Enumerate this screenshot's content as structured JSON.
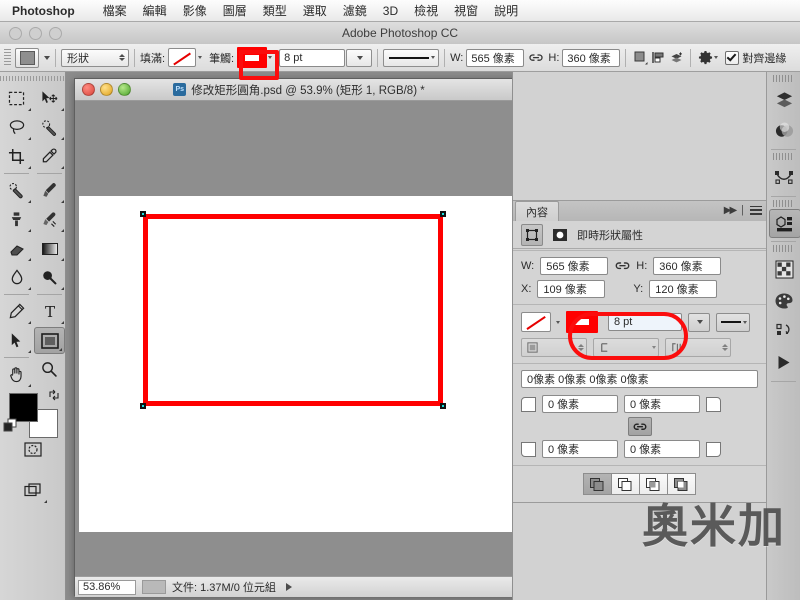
{
  "menubar": {
    "app_name": "Photoshop",
    "items": [
      "檔案",
      "編輯",
      "影像",
      "圖層",
      "類型",
      "選取",
      "濾鏡",
      "3D",
      "檢視",
      "視窗",
      "說明"
    ]
  },
  "window": {
    "title": "Adobe Photoshop CC"
  },
  "options_bar": {
    "tool_preset_label": "",
    "mode_value": "形狀",
    "fill_label": "填滿:",
    "stroke_label": "筆觸:",
    "stroke_width_value": "8 pt",
    "stroke_color": "#ff0000",
    "width_label": "W:",
    "width_value": "565 像素",
    "height_label": "H:",
    "height_value": "360 像素",
    "align_edges_label": "對齊邊緣",
    "align_edges_checked": true
  },
  "toolbar": {
    "tools_col1": [
      {
        "name": "marquee-tool"
      },
      {
        "name": "lasso-tool"
      },
      {
        "name": "crop-tool"
      },
      {
        "name": "healing-brush-tool"
      },
      {
        "name": "clone-stamp-tool"
      },
      {
        "name": "eraser-tool"
      },
      {
        "name": "blur-tool"
      },
      {
        "name": "pen-tool"
      },
      {
        "name": "path-selection-tool"
      },
      {
        "name": "hand-tool"
      }
    ],
    "tools_col2": [
      {
        "name": "move-tool"
      },
      {
        "name": "quick-selection-tool"
      },
      {
        "name": "eyedropper-tool"
      },
      {
        "name": "brush-tool"
      },
      {
        "name": "history-brush-tool"
      },
      {
        "name": "gradient-tool"
      },
      {
        "name": "dodge-tool"
      },
      {
        "name": "type-tool"
      },
      {
        "name": "rectangle-tool"
      },
      {
        "name": "zoom-tool"
      }
    ],
    "foreground_color": "#000000",
    "background_color": "#ffffff",
    "selected_tool": "rectangle-tool"
  },
  "document": {
    "title": "修改矩形圓角.psd @ 53.9% (矩形 1, RGB/8) *",
    "file_badge": "Ps",
    "zoom_value": "53.86%",
    "status_text": "文件: 1.37M/0 位元組",
    "shape": {
      "stroke_color": "#ff0000",
      "stroke_width_pt": 8,
      "fill": "none"
    }
  },
  "properties_panel": {
    "tab_label": "內容",
    "header_title": "即時形狀屬性",
    "width_label": "W:",
    "width_value": "565 像素",
    "height_label": "H:",
    "height_value": "360 像素",
    "x_label": "X:",
    "x_value": "109 像素",
    "y_label": "Y:",
    "y_value": "120 像素",
    "stroke_width_value": "8 pt",
    "stroke_color": "#ff0000",
    "corner_summary": "0像素 0像素 0像素 0像素",
    "corner_tl": "0 像素",
    "corner_tr": "0 像素",
    "corner_bl": "0 像素",
    "corner_br": "0 像素",
    "path_operations": [
      "combine-shapes",
      "subtract-front-shape",
      "intersect-shape-areas",
      "exclude-overlapping-shapes"
    ],
    "selected_path_operation": "combine-shapes"
  },
  "right_dock": {
    "icons": [
      {
        "name": "layers-panel-icon"
      },
      {
        "name": "adjustments-panel-icon"
      },
      {
        "name": "paths-panel-icon"
      },
      {
        "name": "properties-panel-icon",
        "selected": true
      },
      {
        "name": "swatches-panel-icon"
      },
      {
        "name": "color-panel-icon"
      },
      {
        "name": "history-panel-icon"
      },
      {
        "name": "actions-panel-icon"
      }
    ]
  },
  "annotations": {
    "accent_color": "#fb0d0d",
    "highlighted_items": [
      "options-bar-stroke-swatch",
      "properties-stroke-width-field"
    ]
  },
  "watermark": {
    "text": "奧米加"
  }
}
